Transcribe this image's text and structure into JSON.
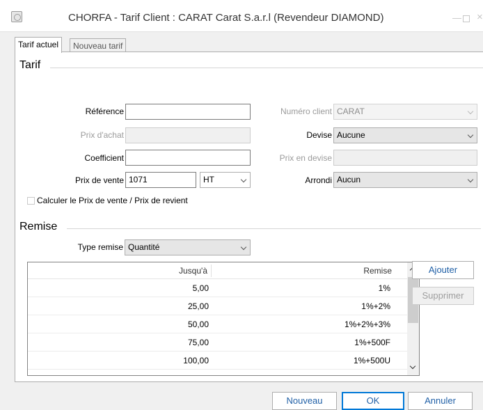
{
  "window": {
    "title": "CHORFA - Tarif Client : CARAT Carat S.a.r.l (Revendeur DIAMOND)",
    "minimize": "—",
    "close": "×"
  },
  "tabs": [
    {
      "label": "Tarif actuel",
      "active": true
    },
    {
      "label": "Nouveau tarif",
      "active": false
    }
  ],
  "tarif": {
    "section_title": "Tarif",
    "reference_label": "Référence",
    "reference_value": "",
    "prix_achat_label": "Prix d'achat",
    "prix_achat_value": "",
    "coefficient_label": "Coefficient",
    "coefficient_value": "",
    "prix_vente_label": "Prix de vente",
    "prix_vente_value": "1071",
    "tax_mode": "HT",
    "numero_client_label": "Numéro client",
    "numero_client_value": "CARAT",
    "devise_label": "Devise",
    "devise_value": "Aucune",
    "prix_devise_label": "Prix en devise",
    "prix_devise_value": "",
    "arrondi_label": "Arrondi",
    "arrondi_value": "Aucun",
    "calc_checkbox_label": "Calculer le Prix de vente / Prix de revient",
    "calc_checked": false
  },
  "remise": {
    "section_title": "Remise",
    "type_label": "Type remise",
    "type_value": "Quantité",
    "columns": [
      "Jusqu'à",
      "Remise"
    ],
    "rows": [
      {
        "jusqua": "5,00",
        "remise": "1%"
      },
      {
        "jusqua": "25,00",
        "remise": "1%+2%"
      },
      {
        "jusqua": "50,00",
        "remise": "1%+2%+3%"
      },
      {
        "jusqua": "75,00",
        "remise": "1%+500F"
      },
      {
        "jusqua": "100,00",
        "remise": "1%+500U"
      }
    ],
    "add_button": "Ajouter",
    "delete_button": "Supprimer"
  },
  "footer": {
    "new_button": "Nouveau",
    "ok_button": "OK",
    "cancel_button": "Annuler"
  },
  "colors": {
    "accent": "#0078d7",
    "link_text": "#1f5fa6"
  }
}
